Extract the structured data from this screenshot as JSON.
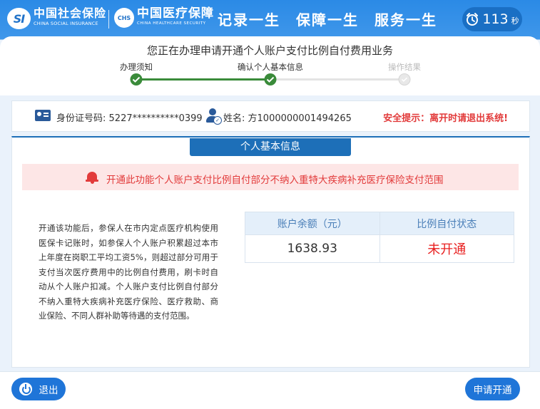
{
  "header": {
    "si_logo_mark": "SI",
    "si_logo_cn": "中国社会保险",
    "si_logo_en": "CHINA SOCIAL INSURANCE",
    "chs_logo_mark": "CHS",
    "chs_logo_cn": "中国医疗保障",
    "chs_logo_en": "CHINA HEALTHCARE SECURITY",
    "slogans": [
      "记录一生",
      "保障一生",
      "服务一生"
    ],
    "timer_value": "113",
    "timer_unit": "秒"
  },
  "page_title": "您正在办理申请开通个人账户支付比例自付费用业务",
  "steps": [
    {
      "label": "办理须知",
      "status": "done"
    },
    {
      "label": "确认个人基本信息",
      "status": "done"
    },
    {
      "label": "操作结果",
      "status": "pending"
    }
  ],
  "info_bar": {
    "id_label": "身份证号码:",
    "id_value": "5227**********0399",
    "name_label": "姓名:",
    "name_value": "方1000000001494265",
    "safety_tip": "安全提示：离开时请退出系统!"
  },
  "section_title": "个人基本信息",
  "notice": "开通此功能个人账户支付比例自付部分不纳入重特大疾病补充医疗保险支付范围",
  "description": "开通该功能后，参保人在市内定点医疗机构使用医保卡记账时，如参保人个人账户积累超过本市上年度在岗职工平均工资5%，则超过部分可用于支付当次医疗费用中的比例自付费用，刷卡时自动从个人账户扣减。个人账户支付比例自付部分不纳入重特大疾病补充医疗保险、医疗救助、商业保险、不同人群补助等待遇的支付范围。",
  "account_table": {
    "headers": [
      "账户余额（元）",
      "比例自付状态"
    ],
    "balance": "1638.93",
    "status": "未开通"
  },
  "footer": {
    "exit_label": "退出",
    "apply_label": "申请开通"
  },
  "colors": {
    "header_blue": "#2b8ae6",
    "primary_button": "#1f75d8",
    "step_done": "#3a8b3a",
    "alert_red": "#e23b3b",
    "status_red": "#e82020"
  }
}
